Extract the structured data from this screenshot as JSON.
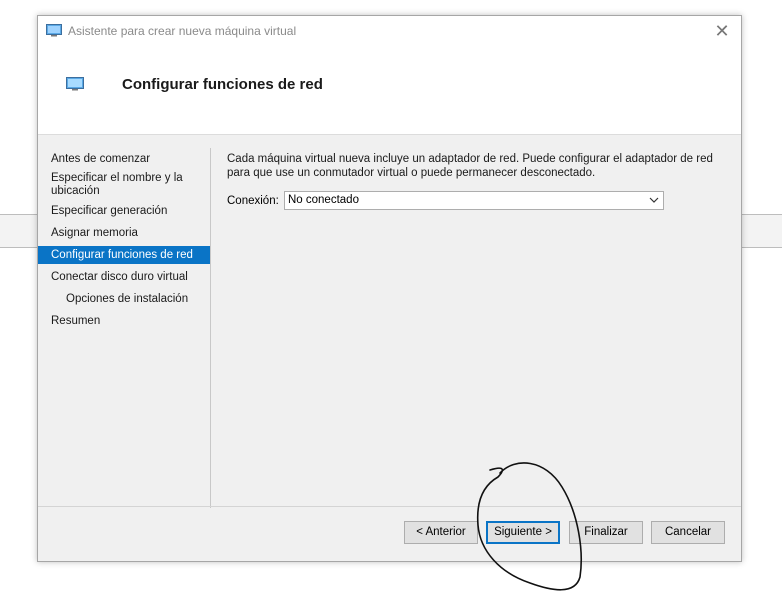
{
  "window": {
    "title": "Asistente para crear nueva máquina virtual",
    "close_icon": "close-icon"
  },
  "header": {
    "title": "Configurar funciones de red"
  },
  "nav": {
    "items": [
      {
        "label": "Antes de comenzar"
      },
      {
        "label": "Especificar el nombre y la ubicación"
      },
      {
        "label": "Especificar generación"
      },
      {
        "label": "Asignar memoria"
      },
      {
        "label": "Configurar funciones de red",
        "active": true
      },
      {
        "label": "Conectar disco duro virtual"
      },
      {
        "label": "Opciones de instalación",
        "sub": true
      },
      {
        "label": "Resumen"
      }
    ]
  },
  "content": {
    "description": "Cada máquina virtual nueva incluye un adaptador de red. Puede configurar el adaptador de red para que use un conmutador virtual o puede permanecer desconectado.",
    "connection_label": "Conexión:",
    "connection_value": "No conectado"
  },
  "buttons": {
    "back": "< Anterior",
    "next": "Siguiente >",
    "finish": "Finalizar",
    "cancel": "Cancelar"
  },
  "colors": {
    "accent": "#0a74c6",
    "body_bg": "#f0f0f0"
  }
}
